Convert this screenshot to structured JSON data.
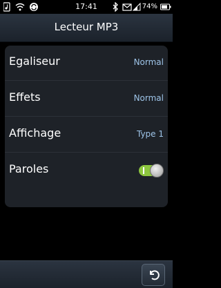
{
  "status_bar": {
    "time": "17:41",
    "battery_percent": "74%",
    "icons": [
      "music-icon",
      "wifi-icon",
      "sync-icon",
      "bluetooth-icon",
      "message-icon",
      "signal-icon",
      "battery-icon"
    ]
  },
  "header": {
    "title": "Lecteur MP3"
  },
  "settings": {
    "items": [
      {
        "label": "Egaliseur",
        "value": "Normal"
      },
      {
        "label": "Effets",
        "value": "Normal"
      },
      {
        "label": "Affichage",
        "value": "Type 1"
      },
      {
        "label": "Paroles",
        "toggle_on": true
      }
    ]
  },
  "footer": {
    "back_icon": "back-arrow-icon"
  },
  "colors": {
    "accent_value": "#9ec4e8",
    "toggle_on": "#8dc63f",
    "panel_bg": "#1e2228"
  }
}
